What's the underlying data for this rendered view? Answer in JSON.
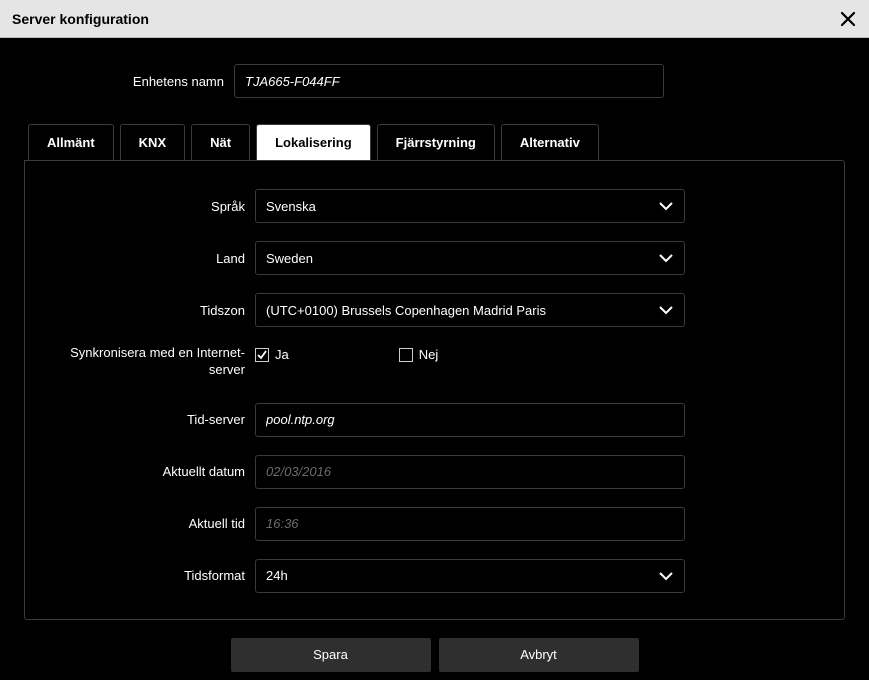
{
  "titlebar": {
    "title": "Server konfiguration"
  },
  "device_name": {
    "label": "Enhetens namn",
    "value": "TJA665-F044FF"
  },
  "tabs": {
    "general": "Allmänt",
    "knx": "KNX",
    "net": "Nät",
    "localization": "Lokalisering",
    "remote": "Fjärrstyrning",
    "alternative": "Alternativ"
  },
  "form": {
    "language": {
      "label": "Språk",
      "value": "Svenska"
    },
    "country": {
      "label": "Land",
      "value": "Sweden"
    },
    "timezone": {
      "label": "Tidszon",
      "value": "(UTC+0100) Brussels Copenhagen Madrid Paris"
    },
    "sync": {
      "label": "Synkronisera med en Internet-server",
      "yes": "Ja",
      "no": "Nej",
      "value": "yes"
    },
    "timeserver": {
      "label": "Tid-server",
      "value": "pool.ntp.org"
    },
    "date": {
      "label": "Aktuellt datum",
      "value": "02/03/2016"
    },
    "time": {
      "label": "Aktuell tid",
      "value": "16:36"
    },
    "timeformat": {
      "label": "Tidsformat",
      "value": "24h"
    }
  },
  "buttons": {
    "save": "Spara",
    "cancel": "Avbryt"
  }
}
